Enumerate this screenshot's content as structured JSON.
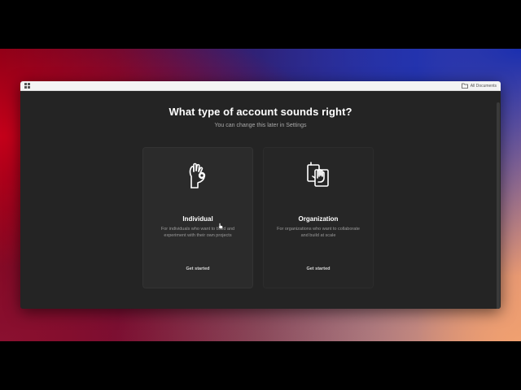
{
  "window": {
    "titlebar": {
      "folder_label": "All Documents"
    }
  },
  "onboarding": {
    "headline": "What type of account sounds right?",
    "subline": "You can change this later in Settings",
    "cards": [
      {
        "icon": "hand-ok-icon",
        "title": "Individual",
        "description": "For individuals who want to build and experiment with their own projects",
        "cta": "Get started"
      },
      {
        "icon": "hands-cards-icon",
        "title": "Organization",
        "description": "For organizations who want to collaborate and build at scale",
        "cta": "Get started"
      }
    ]
  },
  "colors": {
    "window_bg": "#242424",
    "card_bg": "#2b2b2b",
    "text_primary": "#ffffff",
    "text_secondary": "#a8a8a8"
  }
}
